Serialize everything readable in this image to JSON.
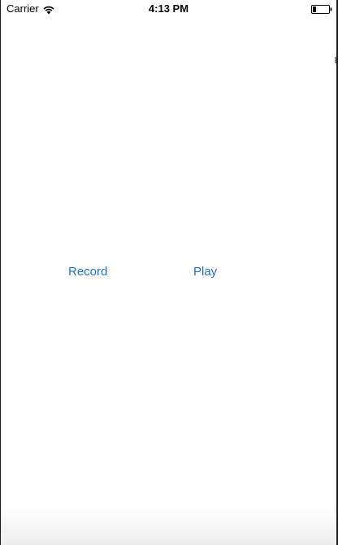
{
  "status_bar": {
    "carrier": "Carrier",
    "time": "4:13 PM",
    "wifi_icon": "wifi-icon",
    "battery_icon": "battery-icon"
  },
  "main": {
    "record_label": "Record",
    "play_label": "Play"
  },
  "colors": {
    "accent": "#1a73d9",
    "background": "#ffffff",
    "text": "#000000"
  }
}
